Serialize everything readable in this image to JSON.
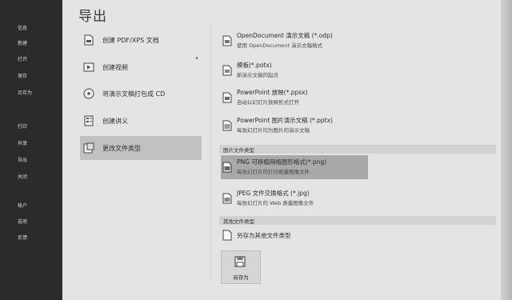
{
  "nav": {
    "items": [
      "信息",
      "新建",
      "打开",
      "保存",
      "另存为",
      "打印",
      "共享",
      "导出",
      "关闭",
      "帐户",
      "选项",
      "反馈"
    ]
  },
  "page_title": "导出",
  "middle": {
    "items": [
      {
        "label": "创建 PDF/XPS 文档",
        "icon": "pdf-document-icon"
      },
      {
        "label": "创建视频",
        "icon": "video-icon"
      },
      {
        "label": "将演示文稿打包成 CD",
        "icon": "cd-package-icon"
      },
      {
        "label": "创建讲义",
        "icon": "handout-icon"
      },
      {
        "label": "更改文件类型",
        "icon": "file-type-icon"
      }
    ]
  },
  "right": {
    "presentation_options": [
      {
        "title": "OpenDocument 演示文稿 (*.odp)",
        "desc": "使用 OpenDocument 演示文稿格式",
        "icon": "odp-file-icon"
      },
      {
        "title": "模板(*.potx)",
        "desc": "新演示文稿的起点",
        "icon": "template-file-icon"
      },
      {
        "title": "PowerPoint 放映(*.ppsx)",
        "desc": "自动以幻灯片放映形式打开",
        "icon": "slideshow-file-icon"
      },
      {
        "title": "PowerPoint 图片演示文稿 (*.pptx)",
        "desc": "每张幻灯片均为图片的演示文稿",
        "icon": "picture-presentation-icon"
      }
    ],
    "image_section_label": "图片文件类型",
    "image_options": [
      {
        "title": "PNG 可移植网络图形格式(*.png)",
        "desc": "每张幻灯片的打印质量图像文件",
        "icon": "png-file-icon"
      },
      {
        "title": "JPEG 文件交换格式 (*.jpg)",
        "desc": "每张幻灯片的 Web 质量图像文件",
        "icon": "jpg-file-icon"
      }
    ],
    "other_section_label": "其他文件类型",
    "other_options": [
      {
        "title": "另存为其他文件类型",
        "icon": "other-file-icon"
      }
    ],
    "save_button_label": "另存为"
  },
  "colors": {
    "nav_bg": "#2b2b2d",
    "panel_bg": "#e4e4e2",
    "selected_bg": "#c1c1bf",
    "option_selected_bg": "#a9a9a7"
  }
}
